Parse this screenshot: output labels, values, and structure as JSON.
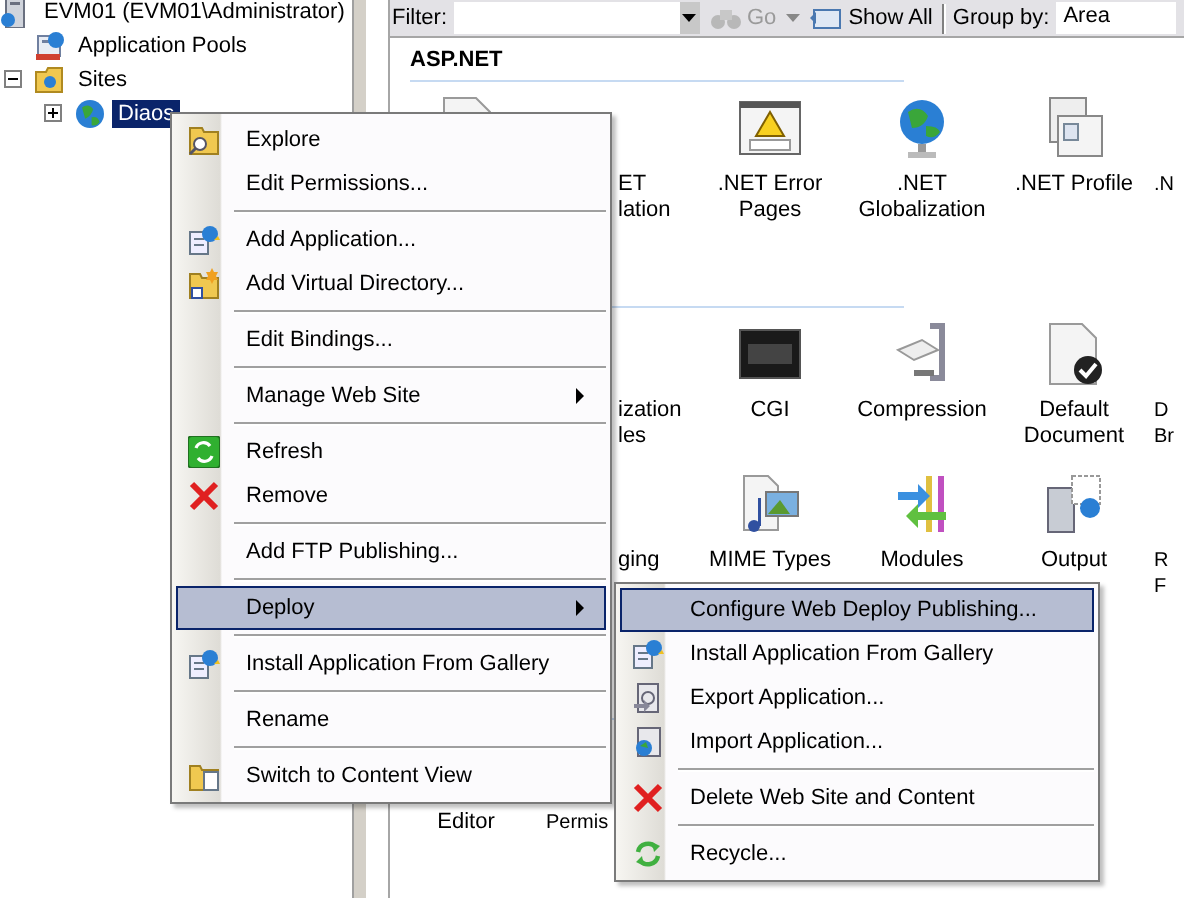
{
  "tree": [
    {
      "label": "EVM01 (EVM01\\Administrator)",
      "selected": false,
      "children": [
        {
          "label": "Application Pools",
          "selected": false
        },
        {
          "label": "Sites",
          "selected": false,
          "expanded": true,
          "children": [
            {
              "label": "Diaos",
              "selected": true,
              "expanded": false
            }
          ]
        }
      ]
    }
  ],
  "toolbar": {
    "filter_label": "Filter:",
    "go": {
      "label": "Go",
      "disabled": true
    },
    "show_all": {
      "label": "Show All"
    },
    "group_by_label": "Group by:",
    "group_by_value": "Area"
  },
  "feature_groups": [
    {
      "title": "ASP.NET",
      "rows": [
        [
          {
            "kind": "covered"
          },
          {
            "kind": "cut-left",
            "lines": [
              "ET",
              "lation"
            ]
          },
          {
            "kind": "full",
            "lines": [
              ".NET Error",
              "Pages"
            ]
          },
          {
            "kind": "full",
            "lines": [
              ".NET",
              "Globalization"
            ]
          },
          {
            "kind": "full",
            "lines": [
              ".NET Profile"
            ]
          },
          {
            "kind": "cut-right",
            "lines": [
              ".N"
            ]
          }
        ]
      ]
    },
    {
      "rows": [
        [
          {
            "kind": "covered"
          },
          {
            "kind": "cut-left",
            "lines": [
              "ization",
              "les"
            ]
          },
          {
            "kind": "full",
            "lines": [
              "CGI"
            ]
          },
          {
            "kind": "full",
            "lines": [
              "Compression"
            ]
          },
          {
            "kind": "full",
            "lines": [
              "Default",
              "Document"
            ]
          },
          {
            "kind": "cut-right",
            "lines": [
              "D",
              "Br"
            ]
          }
        ],
        [
          {
            "kind": "covered"
          },
          {
            "kind": "cut-left",
            "lines": [
              "ging"
            ]
          },
          {
            "kind": "full",
            "lines": [
              "MIME Types"
            ]
          },
          {
            "kind": "full",
            "lines": [
              "Modules"
            ]
          },
          {
            "kind": "full",
            "lines": [
              "Output"
            ]
          },
          {
            "kind": "cut-right",
            "lines": [
              "R",
              "F"
            ]
          }
        ]
      ]
    },
    {
      "rows": [
        [
          {
            "kind": "full",
            "lines": [
              "Editor"
            ]
          },
          {
            "kind": "cut-right",
            "lines": [
              "Permis"
            ]
          }
        ]
      ]
    }
  ],
  "context_menu": [
    {
      "kind": "item",
      "label": "Explore",
      "selected": false,
      "submenu": false
    },
    {
      "kind": "item",
      "label": "Edit Permissions...",
      "selected": false,
      "submenu": false
    },
    {
      "kind": "separator"
    },
    {
      "kind": "item",
      "label": "Add Application...",
      "selected": false,
      "submenu": false
    },
    {
      "kind": "item",
      "label": "Add Virtual Directory...",
      "selected": false,
      "submenu": false
    },
    {
      "kind": "separator"
    },
    {
      "kind": "item",
      "label": "Edit Bindings...",
      "selected": false,
      "submenu": false
    },
    {
      "kind": "separator"
    },
    {
      "kind": "item",
      "label": "Manage Web Site",
      "selected": false,
      "submenu": true
    },
    {
      "kind": "separator"
    },
    {
      "kind": "item",
      "label": "Refresh",
      "selected": false,
      "submenu": false
    },
    {
      "kind": "item",
      "label": "Remove",
      "selected": false,
      "submenu": false
    },
    {
      "kind": "separator"
    },
    {
      "kind": "item",
      "label": "Add FTP Publishing...",
      "selected": false,
      "submenu": false
    },
    {
      "kind": "separator"
    },
    {
      "kind": "item",
      "label": "Deploy",
      "selected": true,
      "submenu": true
    },
    {
      "kind": "separator"
    },
    {
      "kind": "item",
      "label": "Install Application From Gallery",
      "selected": false,
      "submenu": false
    },
    {
      "kind": "separator"
    },
    {
      "kind": "item",
      "label": "Rename",
      "selected": false,
      "submenu": false
    },
    {
      "kind": "separator"
    },
    {
      "kind": "item",
      "label": "Switch to Content View",
      "selected": false,
      "submenu": false
    }
  ],
  "deploy_submenu": [
    {
      "kind": "item",
      "label": "Configure Web Deploy Publishing...",
      "selected": true,
      "submenu": false
    },
    {
      "kind": "item",
      "label": "Install Application From Gallery",
      "selected": false,
      "submenu": false
    },
    {
      "kind": "item",
      "label": "Export Application...",
      "selected": false,
      "submenu": false
    },
    {
      "kind": "item",
      "label": "Import Application...",
      "selected": false,
      "submenu": false
    },
    {
      "kind": "separator"
    },
    {
      "kind": "item",
      "label": "Delete Web Site and Content",
      "selected": false,
      "submenu": false
    },
    {
      "kind": "separator"
    },
    {
      "kind": "item",
      "label": "Recycle...",
      "selected": false,
      "submenu": false
    }
  ]
}
